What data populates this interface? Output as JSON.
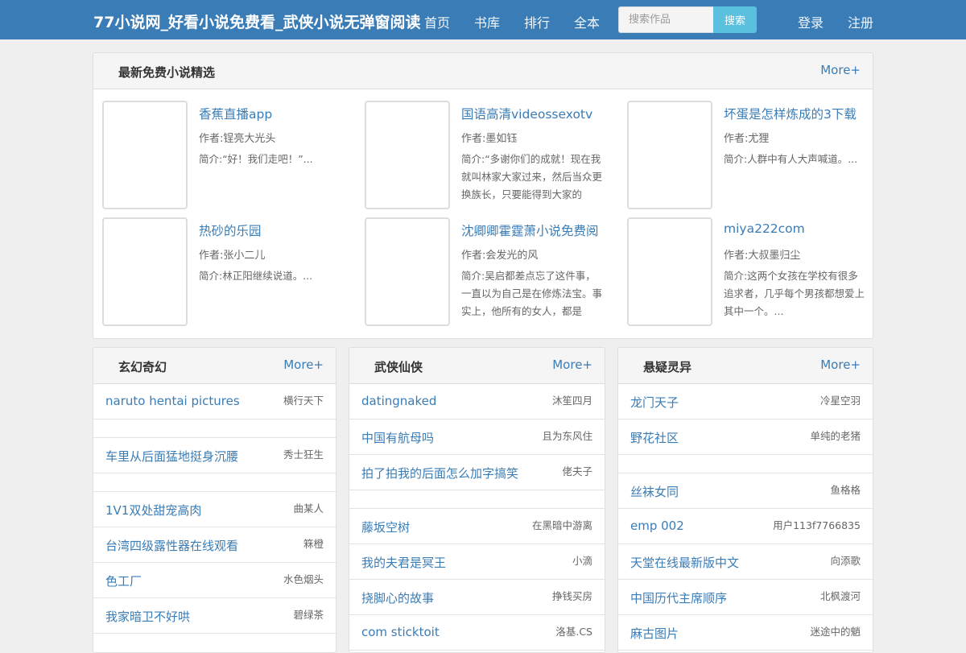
{
  "header": {
    "site_title": "77小说网_好看小说免费看_武侠小说无弹窗阅读",
    "nav": [
      "首页",
      "书库",
      "排行",
      "全本"
    ],
    "search_placeholder": "搜索作品",
    "search_button": "搜索",
    "login": "登录",
    "register": "注册"
  },
  "featured": {
    "title": "最新免费小说精选",
    "more": "More+",
    "items": [
      {
        "title": "香蕉直播app",
        "author": "作者:锃亮大光头",
        "desc": "简介:“好！我们走吧！”..."
      },
      {
        "title": "国语高清videossexotv",
        "author": "作者:墨如钰",
        "desc": "简介:“多谢你们的成就！现在我就叫林家大家过来，然后当众更换族长，只要能得到大家的"
      },
      {
        "title": "坏蛋是怎样炼成的3下载",
        "author": "作者:尤狸",
        "desc": "简介:人群中有人大声喊道。..."
      },
      {
        "title": "热砂的乐园",
        "author": "作者:张小二儿",
        "desc": "简介:林正阳继续说道。..."
      },
      {
        "title": "沈卿卿霍霆萧小说免费阅",
        "author": "作者:会发光的风",
        "desc": "简介:吴启都差点忘了这件事，一直以为自己是在修炼法宝。事实上，他所有的女人，都是"
      },
      {
        "title": "miya222com",
        "author": "作者:大叔墨归尘",
        "desc": "简介:这两个女孩在学校有很多追求者，几乎每个男孩都想爱上其中一个。..."
      }
    ]
  },
  "categories": [
    {
      "title": "玄幻奇幻",
      "more": "More+",
      "rows": [
        {
          "title": "naruto hentai pictures",
          "author": "横行天下"
        },
        {
          "empty": true
        },
        {
          "title": "车里从后面猛地挺身沉腰",
          "author": "秀士狂生"
        },
        {
          "empty": true
        },
        {
          "title": "1V1双处甜宠高肉",
          "author": "曲某人"
        },
        {
          "title": "台湾四级露性器在线观看",
          "author": "箖橙"
        },
        {
          "title": "色工厂",
          "author": "水色烟头"
        },
        {
          "title": "我家暗卫不好哄",
          "author": "碧绿茶"
        }
      ]
    },
    {
      "title": "武侠仙侠",
      "more": "More+",
      "rows": [
        {
          "title": "datingnaked",
          "author": "沐笙四月"
        },
        {
          "title": "中国有航母吗",
          "author": "且为东风住"
        },
        {
          "title": "拍了拍我的后面怎么加字搞笑",
          "author": "佬夫子"
        },
        {
          "empty": true
        },
        {
          "title": "藤坂空树",
          "author": "在黑暗中游离"
        },
        {
          "title": "我的夫君是冥王",
          "author": "小滴"
        },
        {
          "title": "挠脚心的故事",
          "author": "挣钱买房"
        },
        {
          "title": "com sticktoit",
          "author": "洛基.CS"
        }
      ]
    },
    {
      "title": "悬疑灵异",
      "more": "More+",
      "rows": [
        {
          "title": "龙门天子",
          "author": "冷星空羽"
        },
        {
          "title": "野花社区",
          "author": "单纯的老猪"
        },
        {
          "empty": true
        },
        {
          "title": "丝袜女同",
          "author": "鱼格格"
        },
        {
          "title": "emp 002",
          "author": "用户113f7766835"
        },
        {
          "title": "天堂在线最新版中文",
          "author": "向添歌"
        },
        {
          "title": "中国历代主席顺序",
          "author": "北枫渡河"
        },
        {
          "title": "麻古图片",
          "author": "迷途中的魈"
        }
      ]
    }
  ]
}
